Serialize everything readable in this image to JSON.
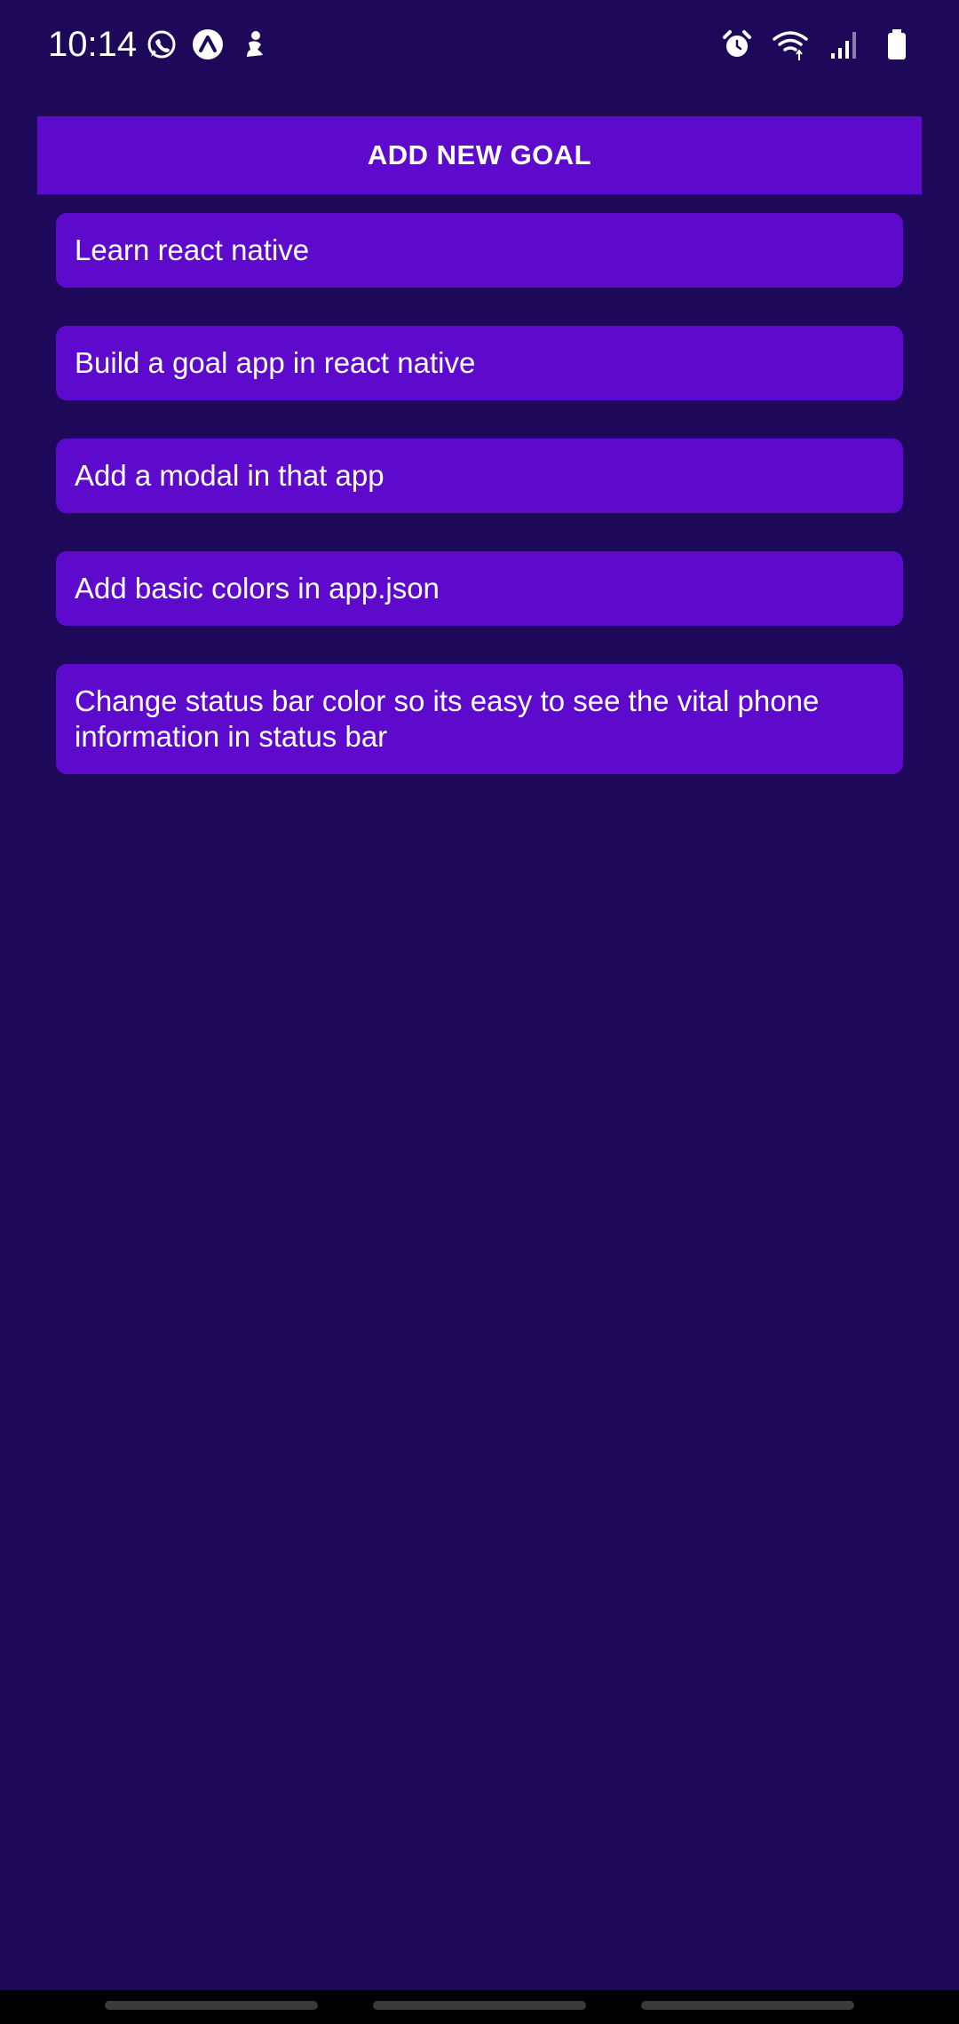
{
  "status_bar": {
    "time": "10:14",
    "left_icons": [
      "whatsapp-icon",
      "expo-icon",
      "notification-icon"
    ],
    "right_icons": [
      "alarm-icon",
      "wifi-icon",
      "signal-icon",
      "battery-icon"
    ]
  },
  "add_goal_button": {
    "label": "ADD NEW GOAL"
  },
  "goals": [
    {
      "text": "Learn react native"
    },
    {
      "text": "Build a goal app in react native"
    },
    {
      "text": "Add a modal in that app"
    },
    {
      "text": "Add basic colors in app.json"
    },
    {
      "text": "Change status bar color so its easy to see the vital phone information in status bar"
    }
  ],
  "colors": {
    "background": "#1e085a",
    "accent": "#5e0acc",
    "text": "#ffffff"
  }
}
